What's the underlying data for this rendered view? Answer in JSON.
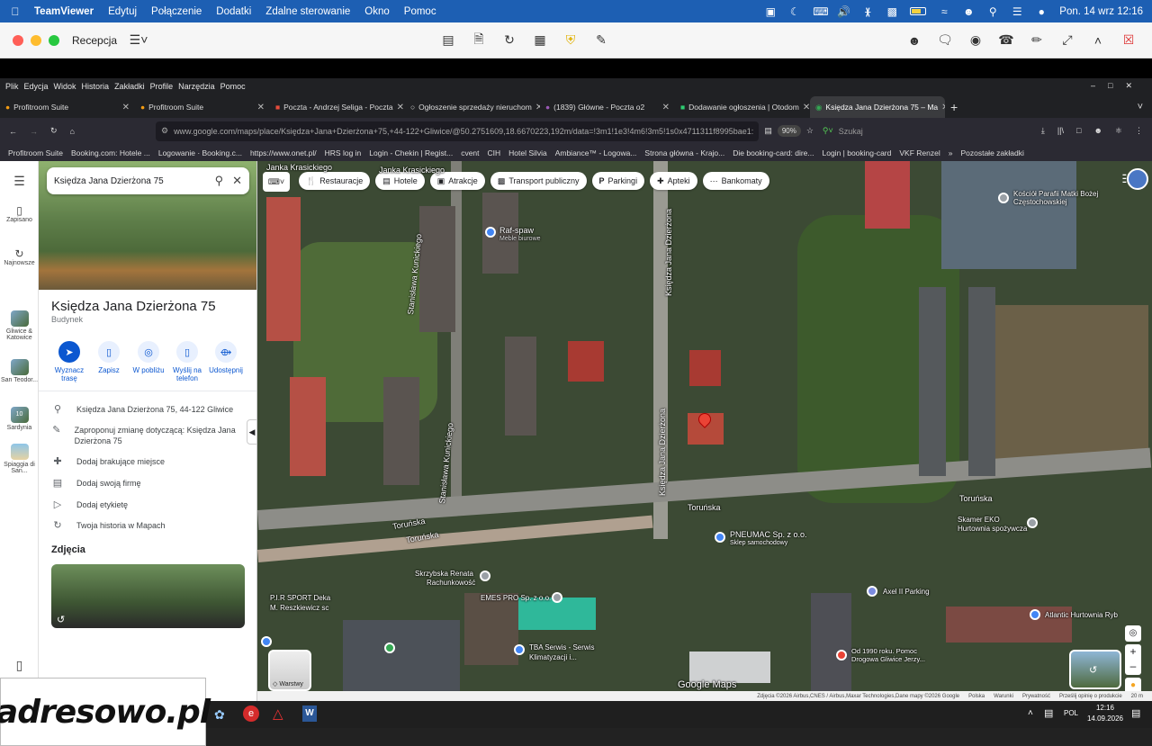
{
  "macbar": {
    "app": "TeamViewer",
    "menus": [
      "Edytuj",
      "Połączenie",
      "Dodatki",
      "Zdalne sterowanie",
      "Okno",
      "Pomoc"
    ],
    "datetime": "Pon. 14 wrz  12:16"
  },
  "teamviewer": {
    "session_title": "Recepcja"
  },
  "firefox": {
    "menu": [
      "Plik",
      "Edycja",
      "Widok",
      "Historia",
      "Zakładki",
      "Profile",
      "Narzędzia",
      "Pomoc"
    ],
    "tabs": [
      {
        "label": "Profitroom Suite"
      },
      {
        "label": "Profitroom Suite"
      },
      {
        "label": "Poczta - Andrzej Seliga - Poczta"
      },
      {
        "label": "Ogłoszenie sprzedaży nieruchom"
      },
      {
        "label": "(1839) Główne - Poczta o2"
      },
      {
        "label": "Dodawanie ogłoszenia | Otodom"
      },
      {
        "label": "Księdza Jana Dzierżona 75 – Ma",
        "active": true
      }
    ],
    "url": "www.google.com/maps/place/Księdza+Jana+Dzierżona+75,+44-122+Gliwice/@50.2751609,18.6670223,192m/data=!3m1!1e3!4m6!3m5!1s0x4711311f8995bae1:",
    "zoom": "90%",
    "search_placeholder": "Szukaj",
    "bookmarks": [
      "Profitroom Suite",
      "Booking.com: Hotele ...",
      "Logowanie · Booking.c...",
      "https://www.onet.pl/",
      "HRS log in",
      "Login - Chekin | Regist...",
      "cvent",
      "CIH",
      "Hotel Silvia",
      "Ambiance™ - Logowa...",
      "Strona główna - Krajo...",
      "Die booking-card: dire...",
      "Login | booking-card",
      "VKF Renzel"
    ],
    "bookmarks_other": "Pozostałe zakładki"
  },
  "rail": {
    "saved": "Zapisano",
    "recent": "Najnowsze",
    "recents": [
      "Gliwice & Katowice",
      "San Teodor...",
      "Sardynia",
      "Spiaggia di San..."
    ],
    "recent_badges": [
      "",
      "",
      "10",
      ""
    ]
  },
  "panel": {
    "search_value": "Księdza Jana Dzierżona 75",
    "title": "Księdza Jana Dzierżona 75",
    "type": "Budynek",
    "actions": [
      "Wyznacz trasę",
      "Zapisz",
      "W pobliżu",
      "Wyślij na telefon",
      "Udostępnij"
    ],
    "rows": [
      "Księdza Jana Dzierżona 75, 44-122 Gliwice",
      "Zaproponuj zmianę dotyczącą: Księdza Jana Dzierżona 75",
      "Dodaj brakujące miejsce",
      "Dodaj swoją firmę",
      "Dodaj etykietę",
      "Twoja historia w Mapach"
    ],
    "photos_header": "Zdjęcia"
  },
  "map": {
    "chips": [
      "Restauracje",
      "Hotele",
      "Atrakcje",
      "Transport publiczny",
      "Parkingi",
      "Apteki",
      "Bankomaty"
    ],
    "labels": [
      "Janka Krasickiego",
      "Janka Krasickiego",
      "Raf-spaw",
      "Meble biurowe",
      "Stanisława Kunickiego",
      "Stanisława Kunickiego",
      "Księdza Jana Dzierżona",
      "Księdza Jana Dzierżona",
      "Toruńska",
      "Toruńska",
      "Toruńska",
      "Toruńska",
      "Kościół Parafii Matki Bożej Częstochowskiej",
      "PNEUMAC Sp. z o.o.",
      "Sklep samochodowy",
      "Skrzybska Renata",
      "Rachunkowość",
      "EMES PRO Sp. z o.o.",
      "P.I.R SPORT Deka",
      "M. Reszkiewicz sc",
      "TBA Serwis - Serwis",
      "Klimatyzacji i...",
      "Axel II Parking",
      "Atlantic Hurtownia Ryb",
      "Od 1990 roku. Pomoc Drogowa Gliwice Jerzy...",
      "Skamer EKO",
      "Hurtownia spożywcza"
    ],
    "layers": "Warstwy",
    "brand": "Google Maps",
    "footer": [
      "Zdjęcia ©2026 Airbus,CNES / Airbus,Maxar Technologies,Dane mapy ©2026 Google",
      "Polska",
      "Warunki",
      "Prywatność",
      "Prześlij opinię o produkcie",
      "20 m"
    ]
  },
  "taskbar": {
    "lang": "POL",
    "time": "12:16",
    "date": "14.09.2026"
  },
  "watermark": "adresowo.pl"
}
